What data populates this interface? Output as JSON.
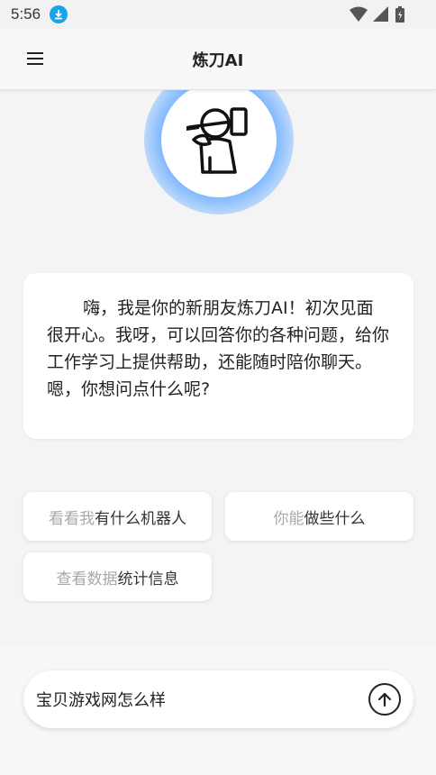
{
  "status_bar": {
    "time": "5:56",
    "icons": [
      "download-icon",
      "wifi-icon",
      "signal-icon",
      "battery-icon"
    ]
  },
  "app_bar": {
    "title": "炼刀AI",
    "menu_icon": "menu-icon"
  },
  "welcome": {
    "avatar_icon": "robot-with-hammer-icon",
    "message": "嗨，我是你的新朋友炼刀AI！初次见面很开心。我呀，可以回答你的各种问题，给你工作学习上提供帮助，还能随时陪你聊天。嗯，你想问点什么呢?"
  },
  "suggestions": [
    {
      "faded": "看看我",
      "dark": "有什么机器人"
    },
    {
      "faded": "你能",
      "dark": "做些什么"
    },
    {
      "faded": "查看数据",
      "dark": "统计信息"
    }
  ],
  "input": {
    "value": "宝贝游戏网怎么样",
    "send_icon": "arrow-up-icon"
  },
  "colors": {
    "accent_blue": "#1aa3e8",
    "glow_blue": "#78b4ff",
    "background": "#f4f4f4"
  }
}
